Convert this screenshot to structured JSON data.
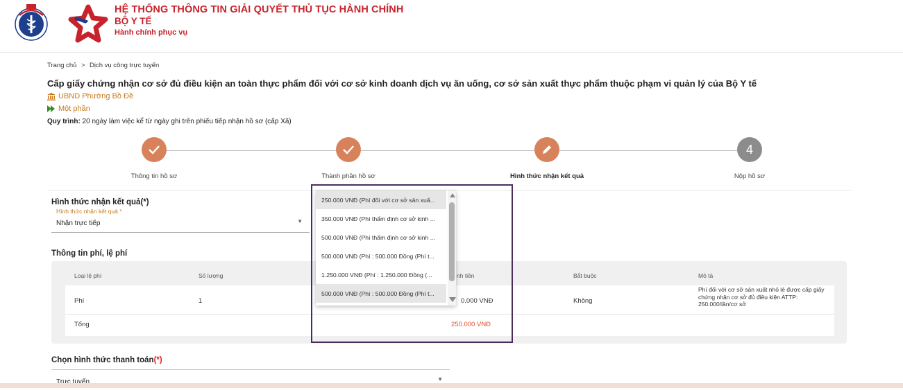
{
  "header": {
    "title": "HỆ THỐNG THÔNG TIN GIẢI QUYẾT THỦ TỤC HÀNH CHÍNH",
    "subtitle": "BỘ Y TẾ",
    "tagline": "Hành chính phục vụ"
  },
  "breadcrumb": {
    "home": "Trang chủ",
    "current": "Dịch vụ công trực tuyến"
  },
  "procedure": {
    "title": "Cấp giấy chứng nhận cơ sở đủ điều kiện an toàn thực phẩm đối với cơ sở kinh doanh dịch vụ ăn uống, cơ sở sản xuất thực phẩm thuộc phạm vi quản lý của Bộ Y tế",
    "agency": "UBND Phường Bồ Đề",
    "level": "Một phần",
    "process_label": "Quy trình:",
    "process_text": " 20 ngày làm việc kể từ ngày ghi trên phiếu tiếp nhận hồ sơ (cấp Xã)"
  },
  "steps": [
    {
      "label": "Thông tin hồ sơ",
      "state": "done"
    },
    {
      "label": "Thành phần hồ sơ",
      "state": "done"
    },
    {
      "label": "Hình thức nhận kết quả",
      "state": "current"
    },
    {
      "label": "Nộp hồ sơ",
      "state": "todo",
      "number": "4"
    }
  ],
  "receive": {
    "section_title": "Hình thức nhận kết quả(*)",
    "field_label": "Hình thức nhận kết quả *",
    "value": "Nhận trực tiếp"
  },
  "fees": {
    "section_title": "Thông tin phí, lệ phí",
    "headers": [
      "Loại lệ phí",
      "Số lượng",
      "Thành tiền",
      "Bắt buộc",
      "Mô tả"
    ],
    "header_visible_amount": "nh tiền",
    "row": {
      "type": "Phí",
      "qty": "1",
      "amount_visible": "0.000 VNĐ",
      "required": "Không",
      "desc": "Phí đối với cơ sở sản xuất nhỏ lẻ được cấp giấy chứng nhận cơ sở đủ điều kiện ATTP: 250.000/lần/cơ sở"
    },
    "total_label": "Tổng",
    "total_value": "250.000 VNĐ"
  },
  "fee_dropdown": {
    "options": [
      "250.000 VNĐ (Phí đối với cơ sở sản xuấ...",
      "350.000 VNĐ (Phí thẩm định cơ sở kinh ...",
      "500.000 VNĐ (Phí thẩm định cơ sở kinh ...",
      "500.000 VNĐ (Phí : 500.000 Đồng (Phí t...",
      "1.250.000 VNĐ (Phí : 1.250.000 Đồng (...",
      "500.000 VNĐ (Phí : 500.000 Đồng (Phí t..."
    ],
    "selected_index": 0
  },
  "payment": {
    "section_title": "Chọn hình thức thanh toán",
    "required_mark": "(*)",
    "value": "Trực tuyến"
  },
  "colors": {
    "brand_red": "#c8232c",
    "step_done": "#d7825a",
    "step_todo": "#8c8c8c",
    "accent_orange": "#c87a1c",
    "highlight_border": "#4a2c5e"
  }
}
